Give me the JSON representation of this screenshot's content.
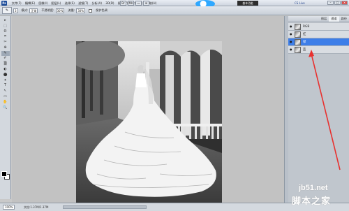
{
  "menubar": {
    "logo": "Ps",
    "items": [
      "文件(F)",
      "编辑(E)",
      "图像(I)",
      "图层(L)",
      "选择(S)",
      "滤镜(T)",
      "分析(A)",
      "3D(D)",
      "视图(V)",
      "窗口(W)",
      "帮助(H)"
    ],
    "toggle_icons": [
      "Br",
      "Mb",
      "▭",
      "⊞"
    ],
    "workspace_label": "基本功能",
    "cslive_label": "CS Live",
    "window_controls": [
      "–",
      "□",
      "×"
    ]
  },
  "options": {
    "tool_glyph": "✎",
    "size_value": "3",
    "mode_label": "模式:",
    "mode_value": "正常",
    "opacity_label": "不透明度:",
    "opacity_value": "30%",
    "flow_label": "流量:",
    "flow_value": "30%",
    "airbrush_label": "保护色调"
  },
  "tools": [
    "▸",
    "⬚",
    "ʘ",
    "⌗",
    "✂",
    "⊕",
    "✎",
    "✐",
    "▒",
    "◐",
    "⬤",
    "✦",
    "T",
    "↖",
    "▭",
    "✋",
    "🔍"
  ],
  "layers": {
    "tabs": [
      "图层",
      "通道",
      "路径"
    ],
    "active_tab": "通道",
    "rows": [
      {
        "name": "RGB",
        "selected": false
      },
      {
        "name": "红",
        "selected": false
      },
      {
        "name": "绿",
        "selected": true
      },
      {
        "name": "蓝",
        "selected": false
      }
    ],
    "eye_glyph": "●"
  },
  "status": {
    "zoom": "100%",
    "doc_info": "文档:1.37M/1.37M"
  },
  "watermark": {
    "url": "jb51.net",
    "site_name": "脚本之家"
  },
  "colors": {
    "selected_layer": "#3d7ee8",
    "annotation_arrow": "#e8312f"
  }
}
